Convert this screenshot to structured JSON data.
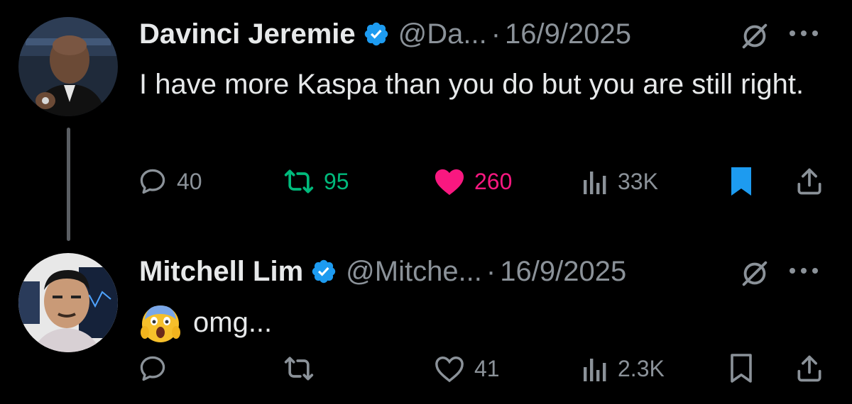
{
  "colors": {
    "background": "#000000",
    "text": "#e7e9ea",
    "muted": "#8b9299",
    "verified": "#1d9bf0",
    "retweet_active": "#00ba7c",
    "like_active": "#f91880",
    "bookmark_active": "#1d9bf0",
    "thread_line": "#5a5e63"
  },
  "tweets": [
    {
      "name": "Davinci Jeremie",
      "handle": "@Da...",
      "separator": "·",
      "date": "16/9/2025",
      "text": "I have more Kaspa than you do but you are still right.",
      "replies": "40",
      "retweets": "95",
      "likes": "260",
      "views": "33K",
      "retweeted": true,
      "liked": true,
      "bookmarked": true,
      "icons": [
        "verified-badge-icon",
        "grok-icon",
        "more-icon",
        "reply-icon",
        "retweet-icon",
        "heart-icon",
        "views-icon",
        "bookmark-icon",
        "share-icon"
      ]
    },
    {
      "name": "Mitchell Lim",
      "handle": "@Mitche...",
      "separator": "·",
      "date": "16/9/2025",
      "emoji": "😱",
      "text": "omg...",
      "replies": "",
      "retweets": "",
      "likes": "41",
      "views": "2.3K",
      "retweeted": false,
      "liked": false,
      "bookmarked": false,
      "icons": [
        "verified-badge-icon",
        "grok-icon",
        "more-icon",
        "reply-icon",
        "retweet-icon",
        "heart-outline-icon",
        "views-icon",
        "bookmark-outline-icon",
        "share-icon"
      ]
    }
  ]
}
